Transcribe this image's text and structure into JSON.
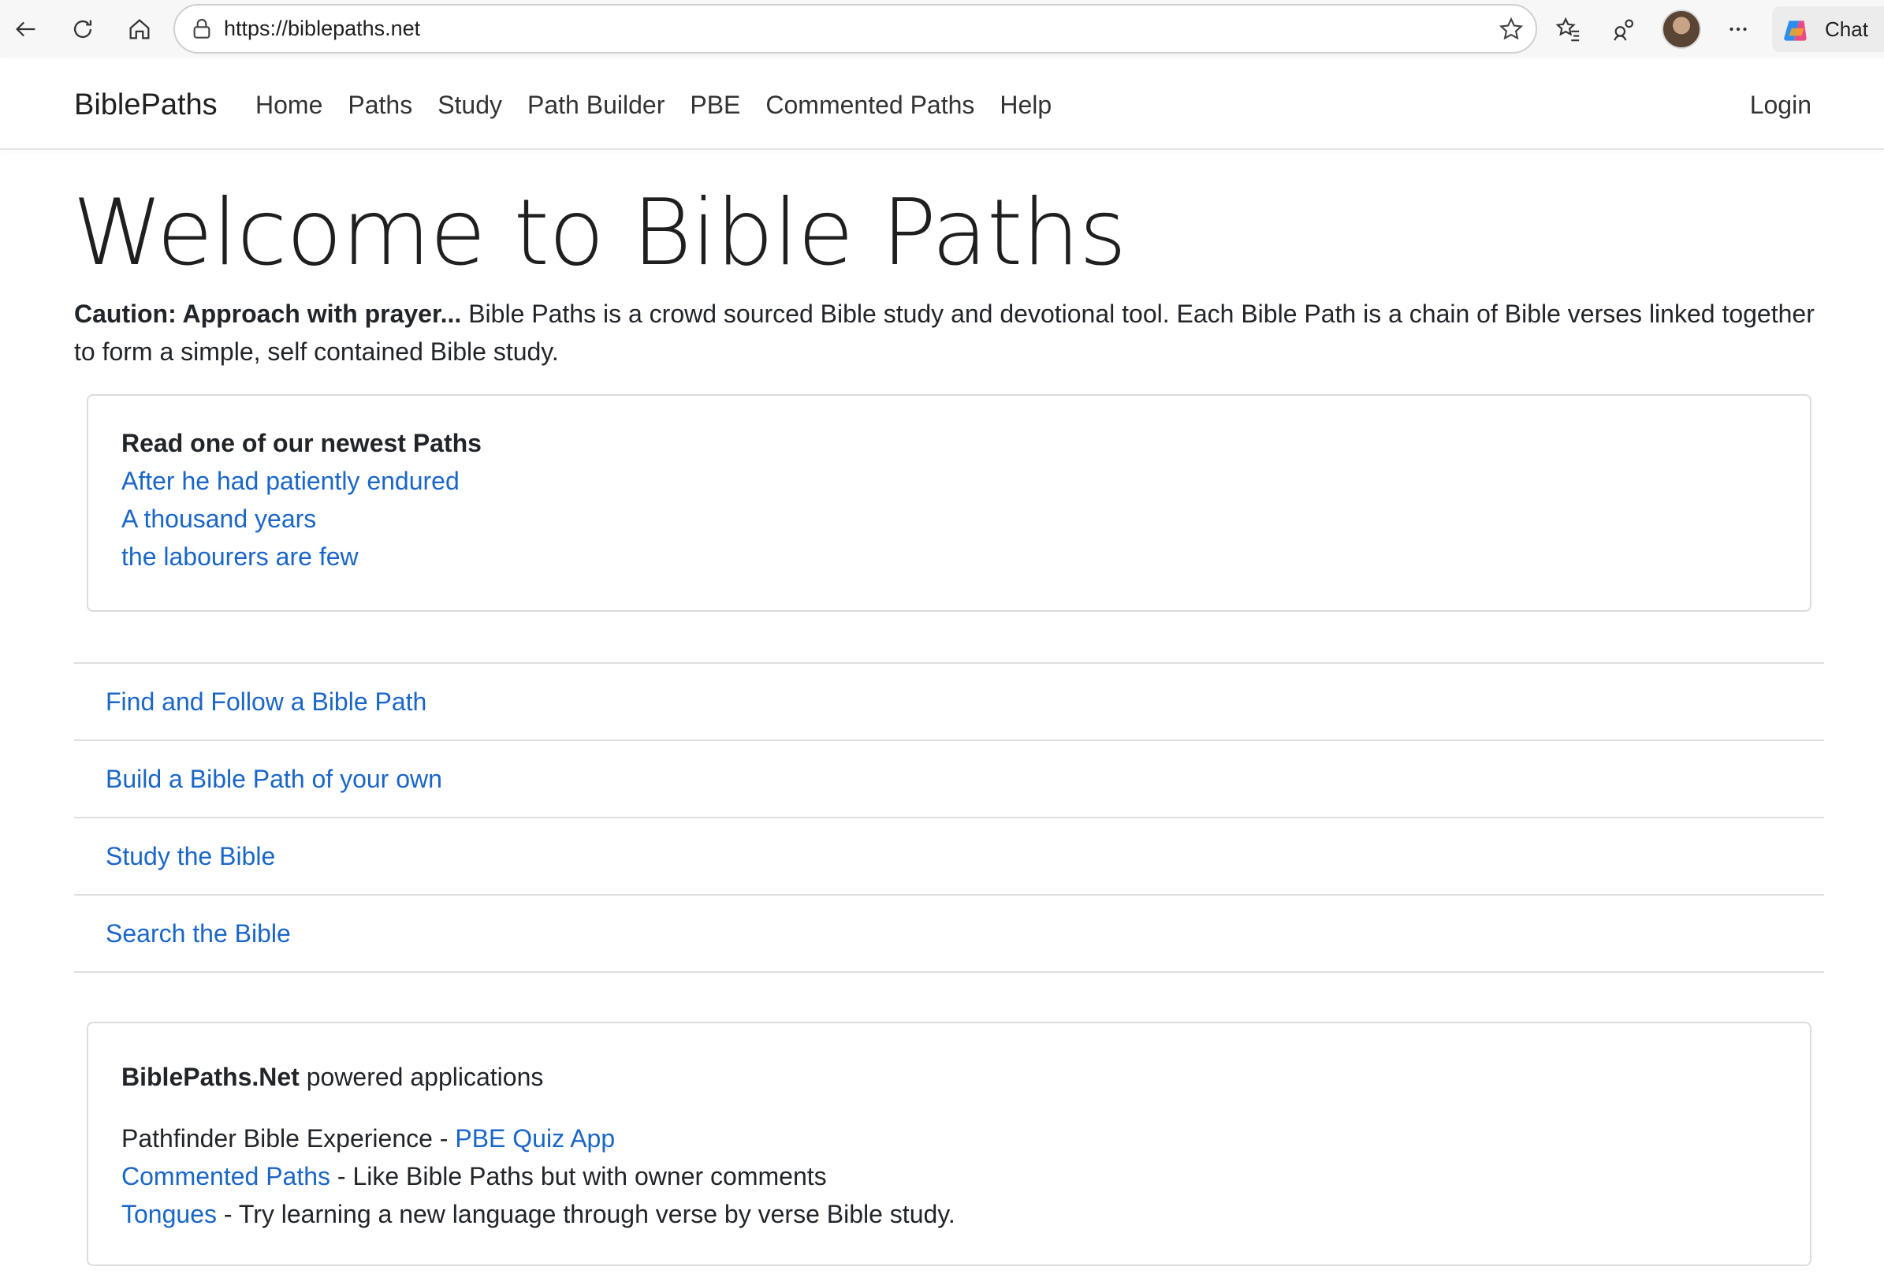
{
  "browser": {
    "url": "https://biblepaths.net",
    "chat_label": "Chat",
    "icons": [
      "back-arrow-icon",
      "refresh-icon",
      "home-icon",
      "lock-icon",
      "star-icon",
      "favorites-icon",
      "extensions-icon",
      "more-icon",
      "copilot-icon"
    ]
  },
  "nav": {
    "brand": "BiblePaths",
    "links": [
      "Home",
      "Paths",
      "Study",
      "Path Builder",
      "PBE",
      "Commented Paths",
      "Help"
    ],
    "login": "Login"
  },
  "hero": {
    "title": "Welcome to Bible Paths",
    "caution": "Caution: Approach with prayer...",
    "intro": " Bible Paths is a crowd sourced Bible study and devotional tool. Each Bible Path is a chain of Bible verses linked together to form a simple, self contained Bible study."
  },
  "newest": {
    "title": "Read one of our newest Paths",
    "paths": [
      "After he had patiently endured",
      "A thousand years",
      "the labourers are few"
    ]
  },
  "actions": [
    "Find and Follow a Bible Path",
    "Build a Bible Path of your own",
    "Study the Bible",
    "Search the Bible"
  ],
  "apps": {
    "brand": "BiblePaths.Net",
    "heading_rest": " powered applications",
    "lines": [
      {
        "pre": "Pathfinder Bible Experience - ",
        "link": "PBE Quiz App",
        "post": ""
      },
      {
        "pre": "",
        "link": "Commented Paths",
        "post": " - Like Bible Paths but with owner comments"
      },
      {
        "pre": "",
        "link": "Tongues",
        "post": " - Try learning a new language through verse by verse Bible study."
      }
    ]
  },
  "colors": {
    "link": "#1a66c7",
    "text": "#212529",
    "border": "#dcdcdc"
  }
}
